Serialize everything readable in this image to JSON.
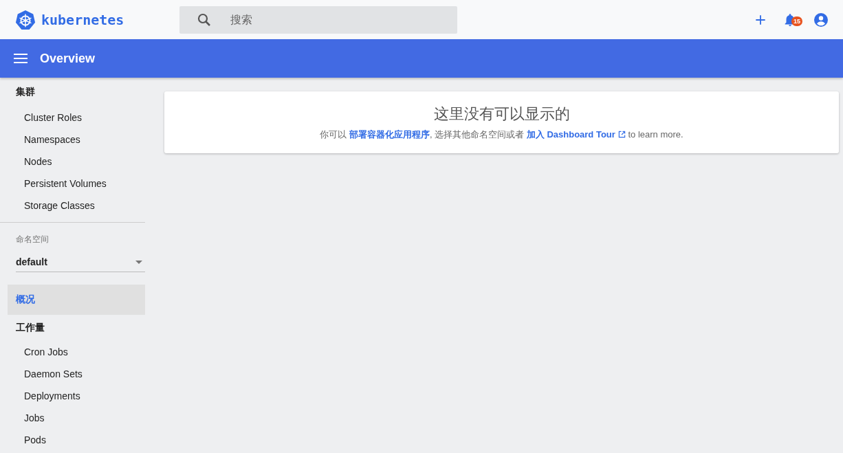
{
  "header": {
    "logo_text": "kubernetes",
    "search": {
      "placeholder": "搜索"
    },
    "notifications": {
      "count": "15"
    }
  },
  "toolbar": {
    "title": "Overview"
  },
  "sidebar": {
    "cluster": {
      "title": "集群",
      "items": [
        {
          "label": "Cluster Roles",
          "selected": false
        },
        {
          "label": "Namespaces",
          "selected": false
        },
        {
          "label": "Nodes",
          "selected": false
        },
        {
          "label": "Persistent Volumes",
          "selected": false
        },
        {
          "label": "Storage Classes",
          "selected": false
        }
      ]
    },
    "namespace": {
      "label": "命名空间",
      "value": "default"
    },
    "overview": {
      "label": "概况",
      "selected": true
    },
    "workloads": {
      "title": "工作量",
      "items": [
        {
          "label": "Cron Jobs",
          "selected": false
        },
        {
          "label": "Daemon Sets",
          "selected": false
        },
        {
          "label": "Deployments",
          "selected": false
        },
        {
          "label": "Jobs",
          "selected": false
        },
        {
          "label": "Pods",
          "selected": false
        }
      ]
    }
  },
  "empty_state": {
    "title": "这里没有可以显示的",
    "message": [
      {
        "kind": "text",
        "text": "你可以 "
      },
      {
        "kind": "link",
        "text": "部署容器化应用程序"
      },
      {
        "kind": "text",
        "text": ", 选择其他命名空间或者 "
      },
      {
        "kind": "external_link",
        "text": "加入 Dashboard Tour"
      },
      {
        "kind": "text",
        "text": " to learn more."
      }
    ]
  }
}
